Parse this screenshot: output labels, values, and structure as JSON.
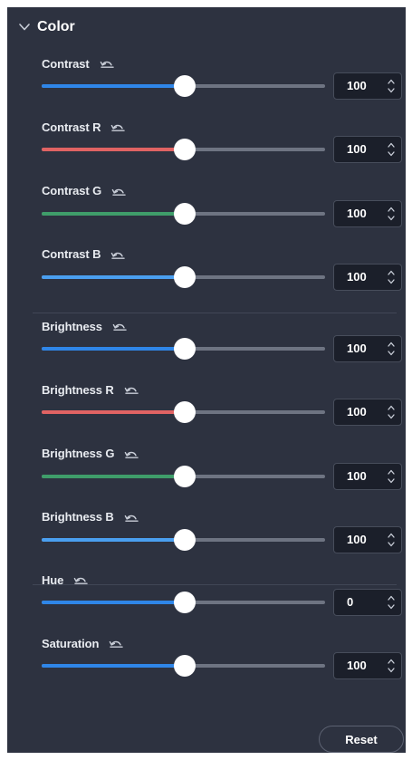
{
  "panel": {
    "title": "Color",
    "icons": {
      "collapse": "chevron-down-icon",
      "reset": "undo-icon",
      "spinner": "spinner-arrows-icon"
    },
    "colors": {
      "blue": "#2f86e8",
      "red": "#e06363",
      "green": "#3f9d6a",
      "lightblue": "#4a9ff0",
      "track": "#6e7482",
      "thumb": "#ffffff"
    },
    "groups": [
      {
        "controls": [
          {
            "id": "contrast",
            "label": "Contrast",
            "value": "100",
            "fill": 0.505,
            "color": "#2f86e8"
          },
          {
            "id": "contrast-r",
            "label": "Contrast R",
            "value": "100",
            "fill": 0.505,
            "color": "#e06363"
          },
          {
            "id": "contrast-g",
            "label": "Contrast G",
            "value": "100",
            "fill": 0.505,
            "color": "#3f9d6a"
          },
          {
            "id": "contrast-b",
            "label": "Contrast B",
            "value": "100",
            "fill": 0.505,
            "color": "#4a9ff0"
          }
        ]
      },
      {
        "controls": [
          {
            "id": "brightness",
            "label": "Brightness",
            "value": "100",
            "fill": 0.505,
            "color": "#2f86e8"
          },
          {
            "id": "brightness-r",
            "label": "Brightness R",
            "value": "100",
            "fill": 0.505,
            "color": "#e06363"
          },
          {
            "id": "brightness-g",
            "label": "Brightness G",
            "value": "100",
            "fill": 0.505,
            "color": "#3f9d6a"
          },
          {
            "id": "brightness-b",
            "label": "Brightness B",
            "value": "100",
            "fill": 0.505,
            "color": "#4a9ff0"
          }
        ]
      },
      {
        "controls": [
          {
            "id": "hue",
            "label": "Hue",
            "value": "0",
            "fill": 0.505,
            "color": "#2f86e8"
          },
          {
            "id": "saturation",
            "label": "Saturation",
            "value": "100",
            "fill": 0.505,
            "color": "#2f86e8"
          }
        ]
      }
    ],
    "reset_label": "Reset"
  }
}
